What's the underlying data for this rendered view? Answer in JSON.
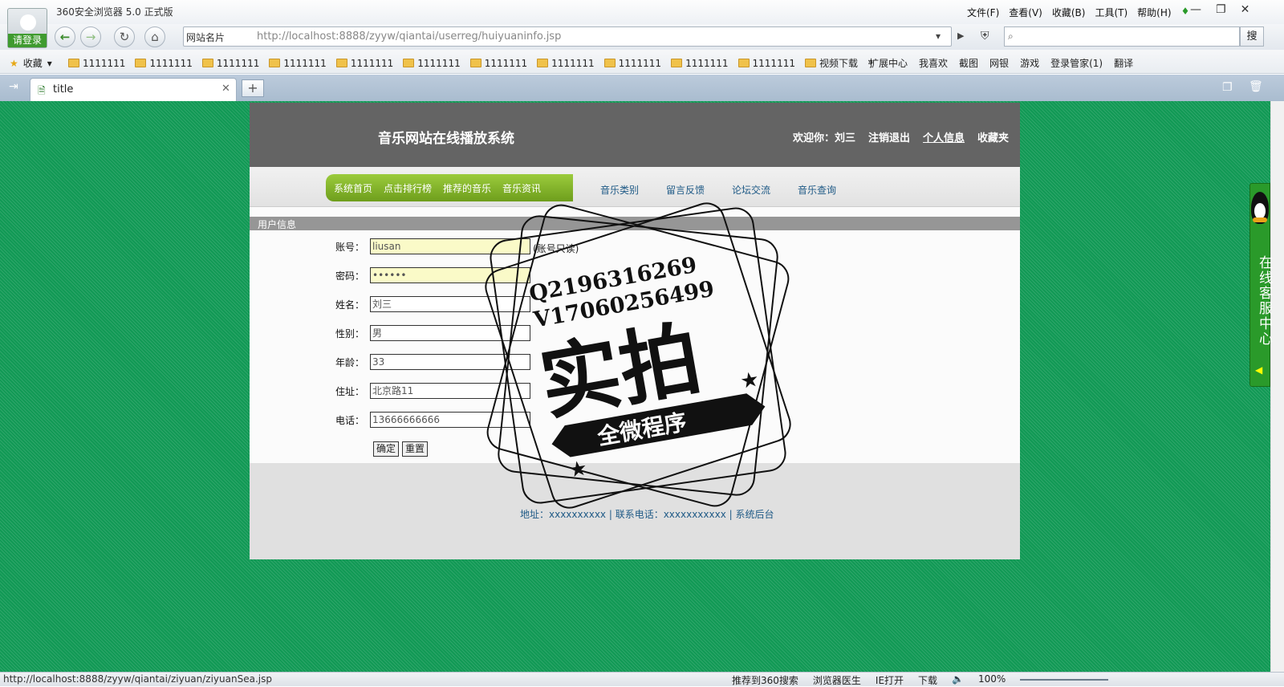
{
  "browser": {
    "app_title": "360安全浏览器 5.0 正式版",
    "login_label": "请登录",
    "menu": [
      "文件(F)",
      "查看(V)",
      "收藏(B)",
      "工具(T)",
      "帮助(H)"
    ],
    "site_name_label": "网站名片",
    "url": "http://localhost:8888/zyyw/qiantai/userreg/huiyuaninfo.jsp",
    "search_button": "搜",
    "favorites_label": "收藏",
    "bookmark_folders": [
      "1111111",
      "1111111",
      "1111111",
      "1111111",
      "1111111",
      "1111111",
      "1111111",
      "1111111",
      "1111111",
      "1111111",
      "1111111",
      "视频下载"
    ],
    "toolbar_items": [
      "扩展中心",
      "我喜欢",
      "截图",
      "网银",
      "游戏",
      "登录管家(1)",
      "翻译"
    ],
    "tab_title": "title",
    "status_url": "http://localhost:8888/zyyw/qiantai/ziyuan/ziyuanSea.jsp",
    "status_items": [
      "推荐到360搜索",
      "浏览器医生",
      "IE打开",
      "下载",
      "100%"
    ]
  },
  "site": {
    "title": "音乐网站在线播放系统",
    "welcome": "欢迎你：刘三",
    "logout": "注销退出",
    "personal_info": "个人信息",
    "favorites": "收藏夹",
    "nav_green": [
      "系统首页",
      "点击排行榜",
      "推荐的音乐",
      "音乐资讯"
    ],
    "nav_gray": [
      "音乐类别",
      "留言反馈",
      "论坛交流",
      "音乐查询"
    ],
    "section_title": "用户信息",
    "form": {
      "account_label": "账号：",
      "account_value": "liusan",
      "account_note": "(账号只读)",
      "password_label": "密码：",
      "password_value": "••••••",
      "name_label": "姓名：",
      "name_value": "刘三",
      "gender_label": "性别：",
      "gender_value": "男",
      "age_label": "年龄：",
      "age_value": "33",
      "address_label": "住址：",
      "address_value": "北京路11",
      "phone_label": "电话：",
      "phone_value": "13666666666",
      "confirm": "确定",
      "reset": "重置"
    },
    "footer": "地址：xxxxxxxxxx | 联系电话：xxxxxxxxxxx | 系统后台"
  },
  "watermark": {
    "line1": "Q2196316269",
    "line2": "V17060256499",
    "big": "实拍",
    "ribbon": "全微程序"
  },
  "side_panel": {
    "text": "在线客服中心"
  }
}
